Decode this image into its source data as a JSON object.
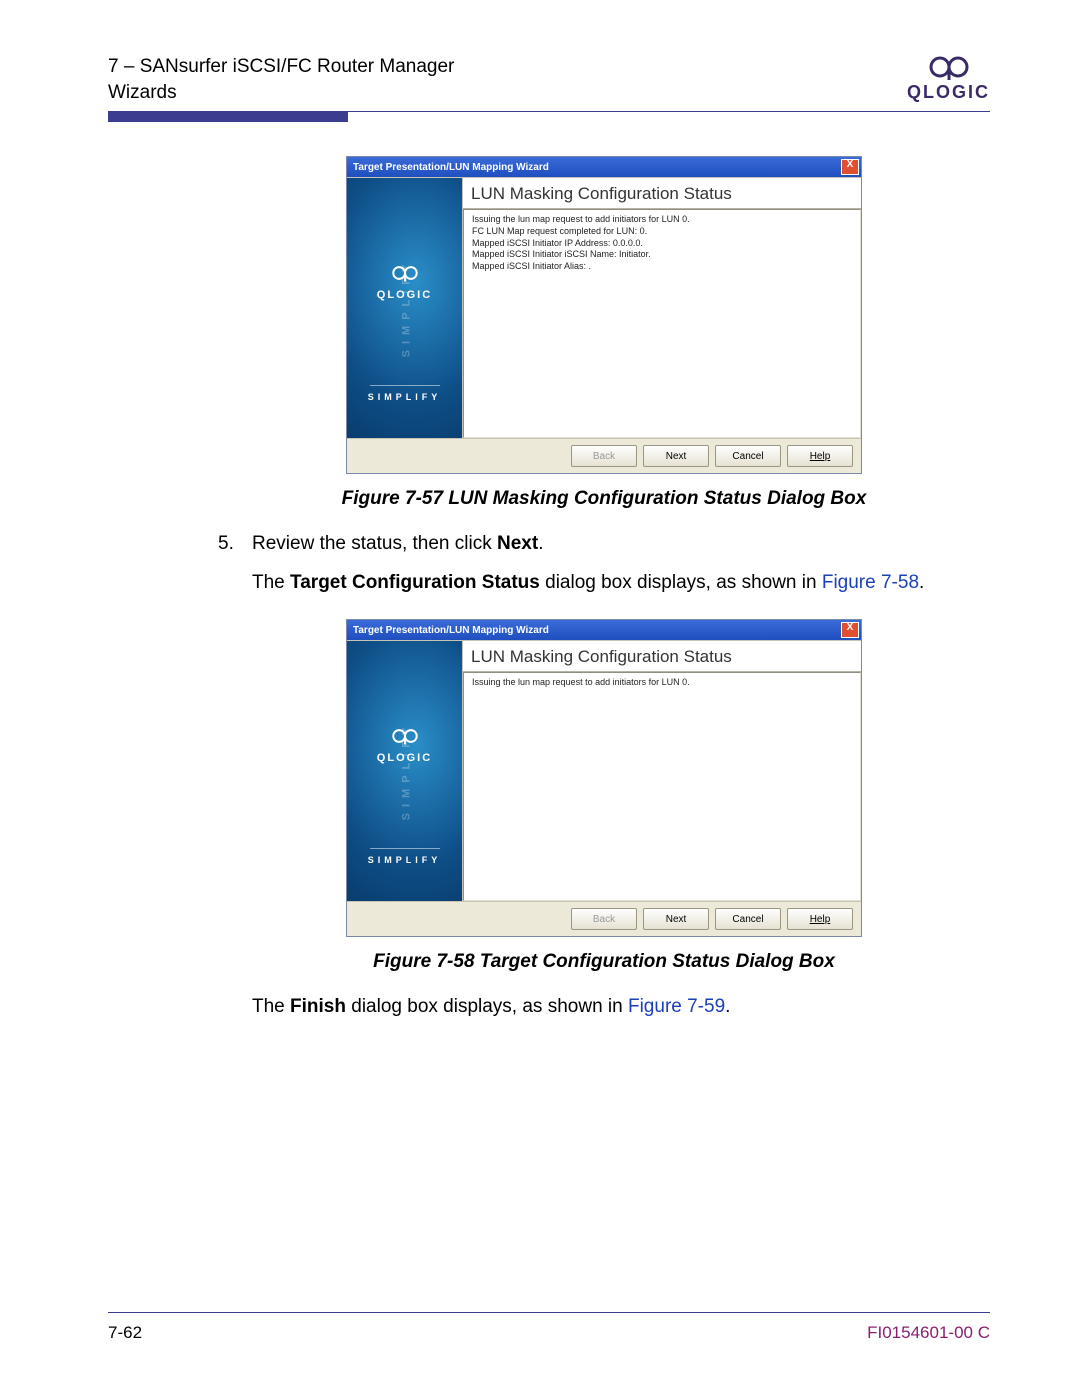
{
  "header": {
    "chapter_line": "7 – SANsurfer iSCSI/FC Router Manager",
    "section_line": "Wizards",
    "logo_text": "QLOGIC"
  },
  "dialog1": {
    "title": "Target Presentation/LUN Mapping Wizard",
    "close": "X",
    "panel_title": "LUN Masking Configuration Status",
    "lines": [
      "Issuing the lun map request to add initiators for LUN 0.",
      "FC LUN Map request completed for LUN:  0.",
      "Mapped iSCSI Initiator IP Address:  0.0.0.0.",
      "Mapped iSCSI Initiator iSCSI Name:  Initiator.",
      "Mapped iSCSI Initiator Alias:  ."
    ],
    "side_logo": "QLOGIC",
    "side_tag": "SIMPLIFY",
    "side_vert": "SIMPLIFY",
    "buttons": {
      "back": "Back",
      "next": "Next",
      "cancel": "Cancel",
      "help": "Help"
    }
  },
  "caption1": "Figure 7-57  LUN Masking Configuration Status Dialog Box",
  "step": {
    "num": "5.",
    "line1_a": "Review the status, then click ",
    "line1_b": "Next",
    "line1_c": ".",
    "line2_a": "The ",
    "line2_b": "Target Configuration Status",
    "line2_c": " dialog box displays, as shown in ",
    "line2_link": "Figure 7-58",
    "line2_d": "."
  },
  "dialog2": {
    "title": "Target Presentation/LUN Mapping Wizard",
    "close": "X",
    "panel_title": "LUN Masking Configuration Status",
    "lines": [
      "Issuing the lun map request to add initiators for LUN 0."
    ],
    "side_logo": "QLOGIC",
    "side_tag": "SIMPLIFY",
    "side_vert": "SIMPLIFY",
    "buttons": {
      "back": "Back",
      "next": "Next",
      "cancel": "Cancel",
      "help": "Help"
    }
  },
  "caption2": "Figure 7-58  Target Configuration Status Dialog Box",
  "post": {
    "a": "The ",
    "b": "Finish",
    "c": " dialog box displays, as shown in ",
    "link": "Figure 7-59",
    "d": "."
  },
  "footer": {
    "left": "7-62",
    "right": "FI0154601-00  C"
  }
}
